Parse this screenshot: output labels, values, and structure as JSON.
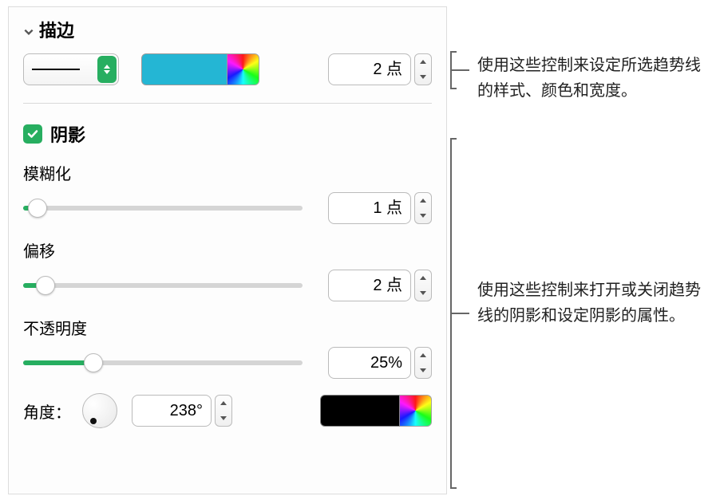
{
  "stroke": {
    "section_title": "描边",
    "width_value": "2 点"
  },
  "shadow": {
    "checkbox_label": "阴影",
    "checked": true,
    "blur": {
      "label": "模糊化",
      "value": "1 点",
      "percent": 5
    },
    "offset": {
      "label": "偏移",
      "value": "2 点",
      "percent": 8
    },
    "opacity": {
      "label": "不透明度",
      "value": "25%",
      "percent": 25
    },
    "angle": {
      "label": "角度：",
      "value": "238°"
    }
  },
  "colors": {
    "stroke_color": "#24b6d4",
    "shadow_color": "#000000"
  },
  "callouts": {
    "stroke": "使用这些控制来设定所选趋势线的样式、颜色和宽度。",
    "shadow": "使用这些控制来打开或关闭趋势线的阴影和设定阴影的属性。"
  }
}
